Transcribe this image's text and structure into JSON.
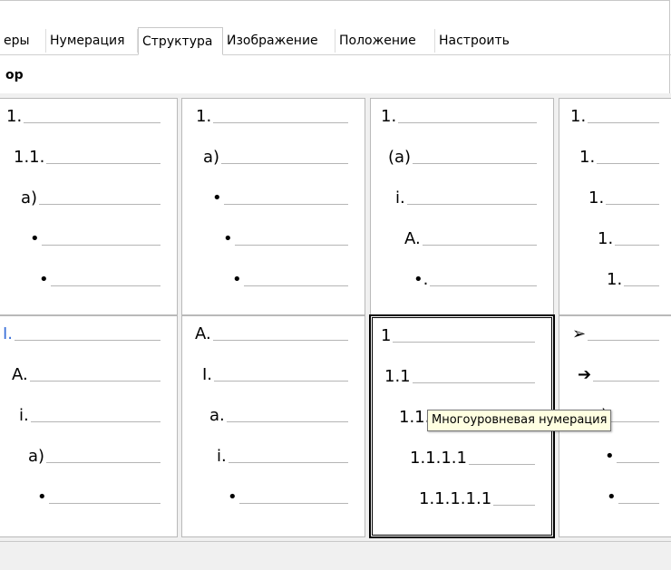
{
  "tabs": [
    {
      "label": "еры",
      "active": false
    },
    {
      "label": "Нумерация",
      "active": false
    },
    {
      "label": "Структура",
      "active": true
    },
    {
      "label": "Изображение",
      "active": false
    },
    {
      "label": "Положение",
      "active": false
    },
    {
      "label": "Настроить",
      "active": false
    }
  ],
  "section_title": "ор",
  "cells": [
    {
      "name": "cell-1",
      "labels": [
        "1.",
        "1.1.",
        "a)",
        "•",
        "•"
      ]
    },
    {
      "name": "cell-2",
      "labels": [
        "1.",
        "a)",
        "•",
        "•",
        "•"
      ]
    },
    {
      "name": "cell-3",
      "labels": [
        "1.",
        "(a)",
        "i.",
        "A.",
        "•."
      ]
    },
    {
      "name": "cell-4",
      "labels": [
        "1.",
        "1.",
        "1.",
        "1.",
        "1."
      ]
    },
    {
      "name": "cell-5",
      "labels": [
        "I.",
        "A.",
        "i.",
        "a)",
        "•"
      ]
    },
    {
      "name": "cell-6",
      "labels": [
        "A.",
        "I.",
        "a.",
        "i.",
        "•"
      ]
    },
    {
      "name": "cell-7",
      "labels": [
        "1",
        "1.1",
        "1.1.1",
        "1.1.1.1",
        "1.1.1.1.1"
      ],
      "selected": true
    },
    {
      "name": "cell-8",
      "labels": [
        "➢",
        "➔",
        ")",
        "•",
        "•"
      ]
    }
  ],
  "tooltip": "Многоуровневая нумерация",
  "colors": {
    "accent_blue": "#3a6fd8",
    "tooltip_bg": "#ffffe1"
  }
}
